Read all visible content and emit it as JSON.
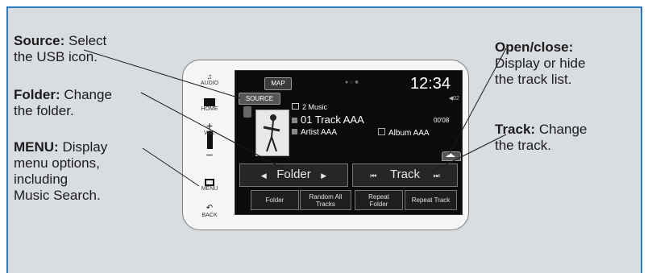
{
  "callouts": {
    "source": {
      "title": "Source:",
      "line1": "Select",
      "line2": "the USB icon."
    },
    "folder": {
      "title": "Folder:",
      "line1": "Change",
      "line2": "the folder."
    },
    "menu": {
      "title": "MENU:",
      "line1": "Display",
      "line2": "menu options,",
      "line3": "including",
      "line4": "Music Search."
    },
    "open_close": {
      "title": "Open/close:",
      "line1": "Display or hide",
      "line2": "the track list."
    },
    "track": {
      "title": "Track:",
      "line1": "Change",
      "line2": "the track."
    }
  },
  "side_buttons": {
    "audio": "AUDIO",
    "home": "HOME",
    "vol": "VOL",
    "menu": "MENU",
    "back": "BACK"
  },
  "screen": {
    "map_label": "MAP",
    "source_label": "SOURCE",
    "clock": "12:34",
    "folder_name": "2 Music",
    "track_name": "01 Track AAA",
    "artist": "Artist AAA",
    "album": "Album AAA",
    "elapsed": "00'08",
    "status": "◀02",
    "folder_ctrl": "Folder",
    "track_ctrl": "Track",
    "bottom_buttons": [
      "Folder",
      "Random All Tracks",
      "Repeat Folder",
      "Repeat Track"
    ]
  },
  "colors": {
    "panel_bg": "#d9dce1",
    "frame_blue": "#2a7ac0"
  }
}
